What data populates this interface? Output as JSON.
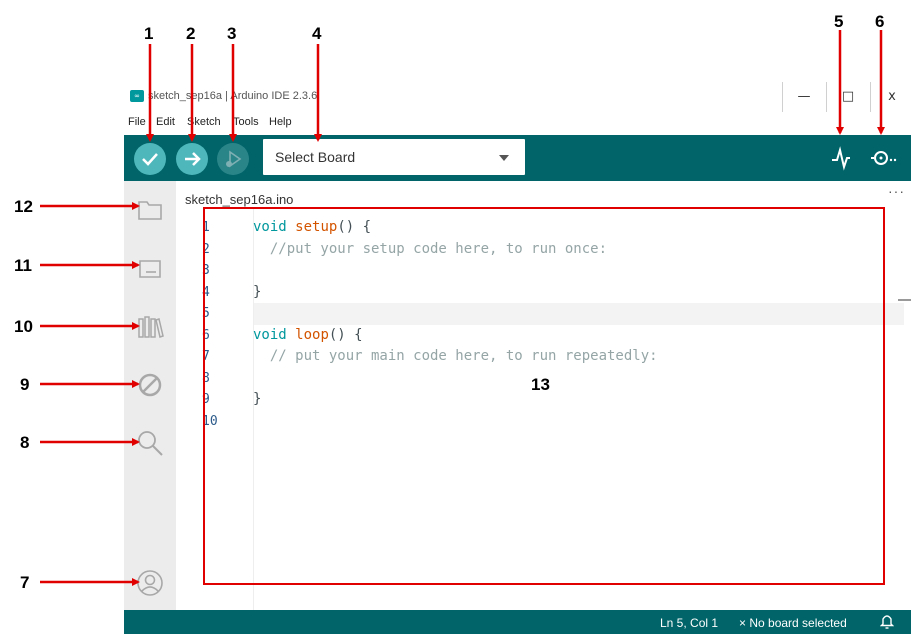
{
  "window": {
    "title": "sketch_sep16a | Arduino IDE 2.3.6",
    "app_icon": "∞",
    "minimize": "—",
    "maximize": "□",
    "close": "x"
  },
  "menu": [
    "File",
    "Edit",
    "Sketch",
    "Tools",
    "Help"
  ],
  "toolbar": {
    "board_select": "Select Board",
    "icons": [
      "verify-icon",
      "upload-icon",
      "debug-icon",
      "serial-plotter-icon",
      "serial-monitor-icon"
    ]
  },
  "sidebar": {
    "icons": [
      "sketchbook-icon",
      "boards-manager-icon",
      "library-manager-icon",
      "debug-icon",
      "search-icon",
      "profile-icon"
    ]
  },
  "tab": {
    "name": "sketch_sep16a.ino",
    "more": "···"
  },
  "editor": {
    "line_numbers": [
      "1",
      "2",
      "3",
      "4",
      "5",
      "6",
      "7",
      "8",
      "9",
      "10"
    ],
    "code": {
      "l1_kw": "void",
      "l1_fn": "setup",
      "l1_rest": "() {",
      "l2_comment": "//put your setup code here, to run once:",
      "l4": "}",
      "l6_kw": "void",
      "l6_fn": "loop",
      "l6_rest": "() {",
      "l7_comment": "// put your main code here, to run repeatedly:",
      "l9": "}"
    }
  },
  "status": {
    "position": "Ln 5, Col 1",
    "board": "No board selected",
    "board_icon": "×"
  },
  "annotations": [
    "1",
    "2",
    "3",
    "4",
    "5",
    "6",
    "7",
    "8",
    "9",
    "10",
    "11",
    "12",
    "13"
  ],
  "colors": {
    "teal_dark": "#006468",
    "teal_button": "#4db7bb",
    "accent": "#00979d",
    "annotation_red": "#e00000"
  }
}
